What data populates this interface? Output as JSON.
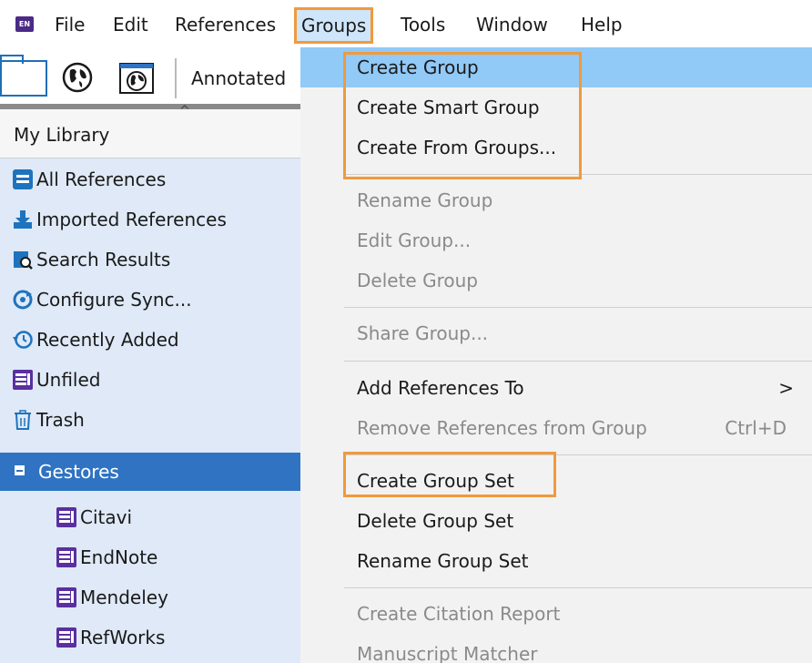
{
  "menubar": {
    "app_icon": "EN",
    "items": [
      "File",
      "Edit",
      "References",
      "Groups",
      "Tools",
      "Window",
      "Help"
    ]
  },
  "toolbar": {
    "icons": [
      "folder-icon",
      "globe-icon",
      "globe-window-icon"
    ],
    "annotated_label": "Annotated"
  },
  "sidebar": {
    "library_title": "My Library",
    "items": [
      {
        "label": "All References",
        "icon": "all-references-icon"
      },
      {
        "label": "Imported References",
        "icon": "import-icon"
      },
      {
        "label": "Search Results",
        "icon": "search-results-icon"
      },
      {
        "label": "Configure Sync...",
        "icon": "sync-icon"
      },
      {
        "label": "Recently Added",
        "icon": "clock-icon"
      },
      {
        "label": "Unfiled",
        "icon": "unfiled-icon"
      },
      {
        "label": "Trash",
        "icon": "trash-icon"
      }
    ],
    "group_set": {
      "label": "Gestores",
      "groups": [
        "Citavi",
        "EndNote",
        "Mendeley",
        "RefWorks"
      ]
    }
  },
  "groups_menu": {
    "items": [
      {
        "label": "Create Group",
        "state": "highlighted"
      },
      {
        "label": "Create Smart Group",
        "state": "enabled"
      },
      {
        "label": "Create From Groups...",
        "state": "enabled"
      },
      {
        "label": "Rename Group",
        "state": "disabled"
      },
      {
        "label": "Edit Group...",
        "state": "disabled"
      },
      {
        "label": "Delete Group",
        "state": "disabled"
      },
      {
        "label": "Share Group...",
        "state": "disabled"
      },
      {
        "label": "Add References To",
        "state": "enabled",
        "submenu_arrow": ">"
      },
      {
        "label": "Remove References from Group",
        "state": "disabled",
        "shortcut": "Ctrl+D"
      },
      {
        "label": "Create Group Set",
        "state": "enabled"
      },
      {
        "label": "Delete Group Set",
        "state": "enabled"
      },
      {
        "label": "Rename Group Set",
        "state": "enabled"
      },
      {
        "label": "Create Citation Report",
        "state": "disabled"
      },
      {
        "label": "Manuscript Matcher",
        "state": "disabled"
      }
    ]
  },
  "colors": {
    "highlight_box": "#f09a3c",
    "menu_active": "#91c9f7",
    "sidebar_bg": "#dfe9f7",
    "group_header_bg": "#2f73c2",
    "group_icon": "#5a2fa0"
  }
}
